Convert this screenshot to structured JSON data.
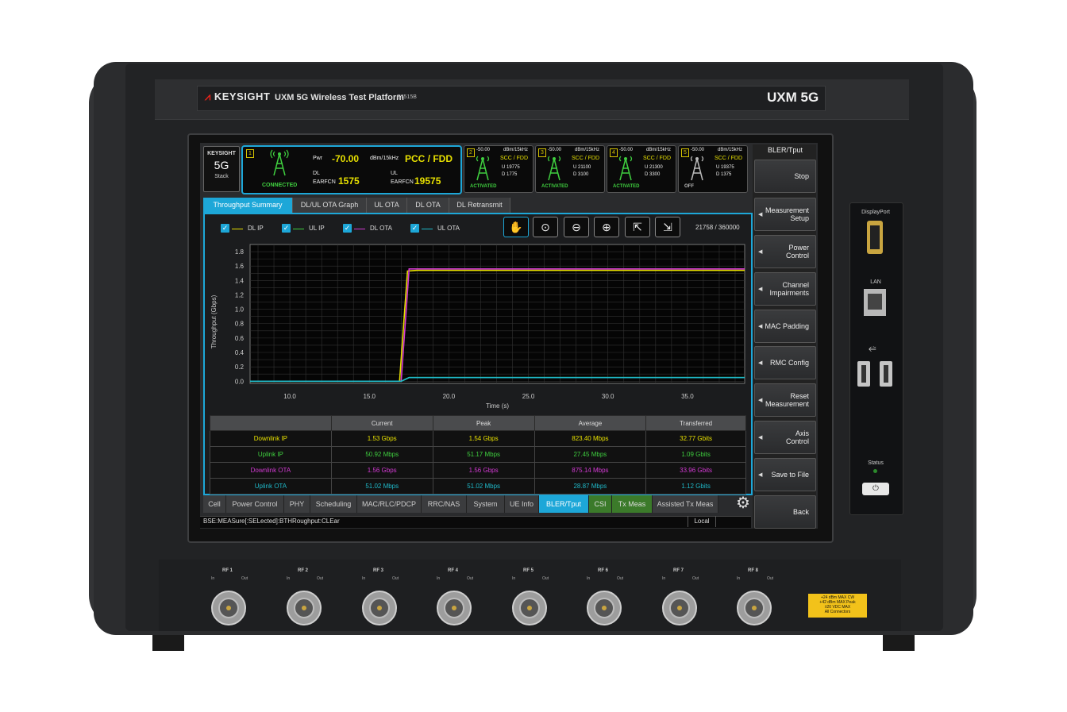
{
  "chassis": {
    "brand": "KEYSIGHT",
    "product_name": "UXM 5G Wireless Test Platform",
    "model": "E7515B",
    "badge": "UXM 5G"
  },
  "stack": {
    "brand": "KEYSIGHT",
    "label": "5G",
    "sub": "Stack"
  },
  "primary_cell": {
    "num": "1",
    "status": "CONNECTED",
    "pwr_label": "Pwr",
    "pwr_value": "-70.00",
    "pwr_unit": "dBm/15kHz",
    "mode": "PCC / FDD",
    "dl_label": "DL",
    "dl_earfcn_label": "EARFCN",
    "dl_earfcn": "1575",
    "ul_label": "UL",
    "ul_earfcn_label": "EARFCN",
    "ul_earfcn": "19575"
  },
  "secondary_cells": [
    {
      "num": "2",
      "pwr": "-50.00",
      "unit": "dBm/15kHz",
      "mode": "SCC / FDD",
      "u": "U 19775",
      "d": "D 1775",
      "status": "ACTIVATED"
    },
    {
      "num": "3",
      "pwr": "-50.00",
      "unit": "dBm/15kHz",
      "mode": "SCC / FDD",
      "u": "U 21100",
      "d": "D 3100",
      "status": "ACTIVATED"
    },
    {
      "num": "4",
      "pwr": "-50.00",
      "unit": "dBm/15kHz",
      "mode": "SCC / FDD",
      "u": "U 21300",
      "d": "D 3300",
      "status": "ACTIVATED"
    },
    {
      "num": "5",
      "pwr": "-50.00",
      "unit": "dBm/15kHz",
      "mode": "SCC / FDD",
      "u": "U 19375",
      "d": "D 1375",
      "status": "OFF"
    }
  ],
  "softkeys": {
    "header": "BLER/Tput",
    "items": [
      "Stop",
      "Measurement\nSetup",
      "Power\nControl",
      "Channel\nImpairments",
      "MAC Padding",
      "RMC Config",
      "Reset\nMeasurement",
      "Axis\nControl",
      "Save to File",
      "Back"
    ]
  },
  "tabs": [
    "Throughput Summary",
    "DL/UL OTA Graph",
    "UL OTA",
    "DL OTA",
    "DL Retransmit"
  ],
  "legend": [
    {
      "label": "DL IP",
      "color": "#e7e000"
    },
    {
      "label": "UL IP",
      "color": "#3fce3f"
    },
    {
      "label": "DL OTA",
      "color": "#d33ad3"
    },
    {
      "label": "UL OTA",
      "color": "#1fb8c8"
    }
  ],
  "toolbar": {
    "icons": [
      "hand-pan-icon",
      "zoom-fit-icon",
      "zoom-out-icon",
      "zoom-in-icon",
      "autoscale-icon",
      "reset-view-icon"
    ],
    "glyphs": [
      "✋",
      "⊙",
      "⊖",
      "⊕",
      "⇱",
      "⇲"
    ],
    "counter": "21758 / 360000"
  },
  "chart_data": {
    "type": "line",
    "xlabel": "Time (s)",
    "ylabel": "Throughput (Gbps)",
    "xlim": [
      7.5,
      38.6
    ],
    "ylim": [
      -0.03,
      1.9
    ],
    "xticks": [
      10.0,
      15.0,
      20.0,
      25.0,
      30.0,
      35.0
    ],
    "xtick_labels": [
      "10.0",
      "15.0",
      "20.0",
      "25.0",
      "30.0",
      "35.0"
    ],
    "yticks": [
      0.0,
      0.2,
      0.4,
      0.6,
      0.8,
      1.0,
      1.2,
      1.4,
      1.6,
      1.8
    ],
    "ytick_labels": [
      "0.0",
      "0.2",
      "0.4",
      "0.6",
      "0.8",
      "1.0",
      "1.2",
      "1.4",
      "1.6",
      "1.8"
    ],
    "grid": true,
    "series": [
      {
        "name": "DL IP",
        "color": "#e7e000",
        "x": [
          7.5,
          16.9,
          17.4,
          18.0,
          25.0,
          30.0,
          38.6
        ],
        "y": [
          0.0,
          0.0,
          1.53,
          1.54,
          1.54,
          1.54,
          1.54
        ]
      },
      {
        "name": "DL OTA",
        "color": "#d33ad3",
        "x": [
          7.5,
          17.0,
          17.5,
          18.0,
          25.0,
          30.0,
          38.6
        ],
        "y": [
          0.0,
          0.0,
          1.56,
          1.56,
          1.56,
          1.56,
          1.56
        ]
      },
      {
        "name": "UL IP",
        "color": "#3fce3f",
        "x": [
          7.5,
          17.0,
          17.5,
          38.6
        ],
        "y": [
          0.0,
          0.0,
          0.05,
          0.05
        ]
      },
      {
        "name": "UL OTA",
        "color": "#1fb8c8",
        "x": [
          7.5,
          17.0,
          17.5,
          38.6
        ],
        "y": [
          0.0,
          0.0,
          0.05,
          0.05
        ]
      }
    ]
  },
  "summary_table": {
    "headers": [
      "",
      "Current",
      "Peak",
      "Average",
      "Transferred"
    ],
    "rows": [
      {
        "color": "#e7e000",
        "cells": [
          "Downlink IP",
          "1.53 Gbps",
          "1.54 Gbps",
          "823.40 Mbps",
          "32.77 Gbits"
        ]
      },
      {
        "color": "#3fce3f",
        "cells": [
          "Uplink IP",
          "50.92 Mbps",
          "51.17 Mbps",
          "27.45 Mbps",
          "1.09 Gbits"
        ]
      },
      {
        "color": "#d33ad3",
        "cells": [
          "Downlink OTA",
          "1.56 Gbps",
          "1.56 Gbps",
          "875.14 Mbps",
          "33.96 Gbits"
        ]
      },
      {
        "color": "#1fb8c8",
        "cells": [
          "Uplink OTA",
          "51.02 Mbps",
          "51.02 Mbps",
          "28.87 Mbps",
          "1.12 Gbits"
        ]
      }
    ]
  },
  "bottom_tabs": [
    "Cell",
    "Power Control",
    "PHY",
    "Scheduling",
    "MAC/RLC/PDCP",
    "RRC/NAS",
    "System",
    "UE Info",
    "BLER/Tput",
    "CSI",
    "Tx Meas",
    "Assisted Tx Meas"
  ],
  "status_bar": {
    "command": "BSE:MEASure[:SELected]:BTHRoughput:CLEar",
    "mode": "Local"
  },
  "io_panel": {
    "displayport": "DisplayPort",
    "lan": "LAN",
    "status": "Status",
    "power_glyph": "⏻"
  },
  "rf_ports": [
    {
      "label": "RF 1",
      "in": "In",
      "out": "Out"
    },
    {
      "label": "RF 2",
      "in": "In",
      "out": "Out"
    },
    {
      "label": "RF 3",
      "in": "In",
      "out": "Out"
    },
    {
      "label": "RF 4",
      "in": "In",
      "out": "Out"
    },
    {
      "label": "RF 5",
      "in": "In",
      "out": "Out"
    },
    {
      "label": "RF 6",
      "in": "In",
      "out": "Out"
    },
    {
      "label": "RF 7",
      "in": "In",
      "out": "Out"
    },
    {
      "label": "RF 8",
      "in": "In",
      "out": "Out"
    }
  ],
  "warning": [
    "+24 dBm MAX CW",
    "+42 dBm MAX Peak",
    "±20 VDC MAX",
    "All Connectors"
  ]
}
